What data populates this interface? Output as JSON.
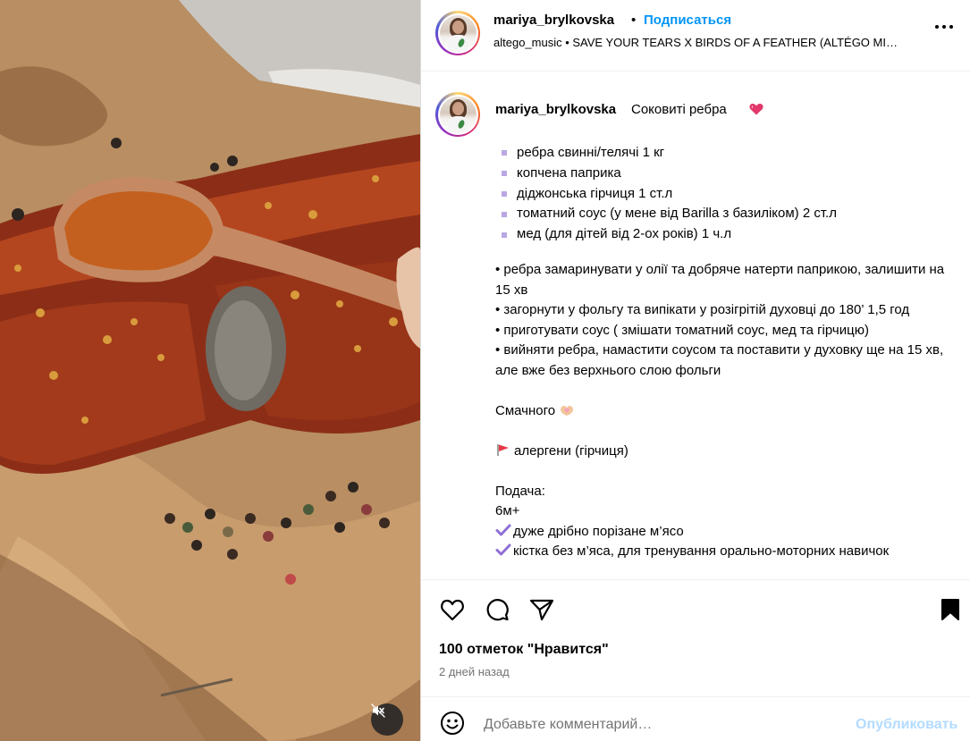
{
  "header": {
    "username": "mariya_brylkovska",
    "separator": "•",
    "follow_label": "Подписаться",
    "music_text": "altego_music • SAVE YOUR TEARS X BIRDS OF A FEATHER (ALTÉGO MI…"
  },
  "caption": {
    "username": "mariya_brylkovska",
    "title": "Соковиті ребра",
    "title_emoji_icon": "heart-icon",
    "ingredients": [
      "ребра свинні/телячі 1 кг",
      "копчена паприка",
      "діджонська гірчиця 1 ст.л",
      "томатний соус (у мене від Barilla з базиліком) 2 ст.л",
      "мед (для дітей від 2-ох років) 1 ч.л"
    ],
    "steps": [
      "• ребра замаринувати у олії та добряче натерти паприкою, залишити на 15 хв",
      "• загорнути у фольгу та випікати у розігрітій духовці до 180’ 1,5 год",
      "• приготувати соус ( змішати томатний соус, мед та гірчицю)",
      "• вийняти ребра, намастити соусом та поставити у духовку ще на 15 хв, але вже без верхнього слою фольги"
    ],
    "enjoy": "Смачного",
    "allergens": "алергени (гірчиця)",
    "serving_title": "Подача:",
    "serving_age": "6м+",
    "serving_items": [
      "дуже дрібно порізане м’ясо",
      "кістка без м’яса, для тренування орально-моторних навичок"
    ]
  },
  "actions": {
    "likes": "100 отметок \"Нравится\"",
    "time": "2 дней назад"
  },
  "comment": {
    "placeholder": "Добавьте комментарий…",
    "post_label": "Опубликовать"
  },
  "colors": {
    "accent": "#0095f6",
    "post_disabled": "#b3dbff",
    "bullet": "#b9a7e3"
  }
}
